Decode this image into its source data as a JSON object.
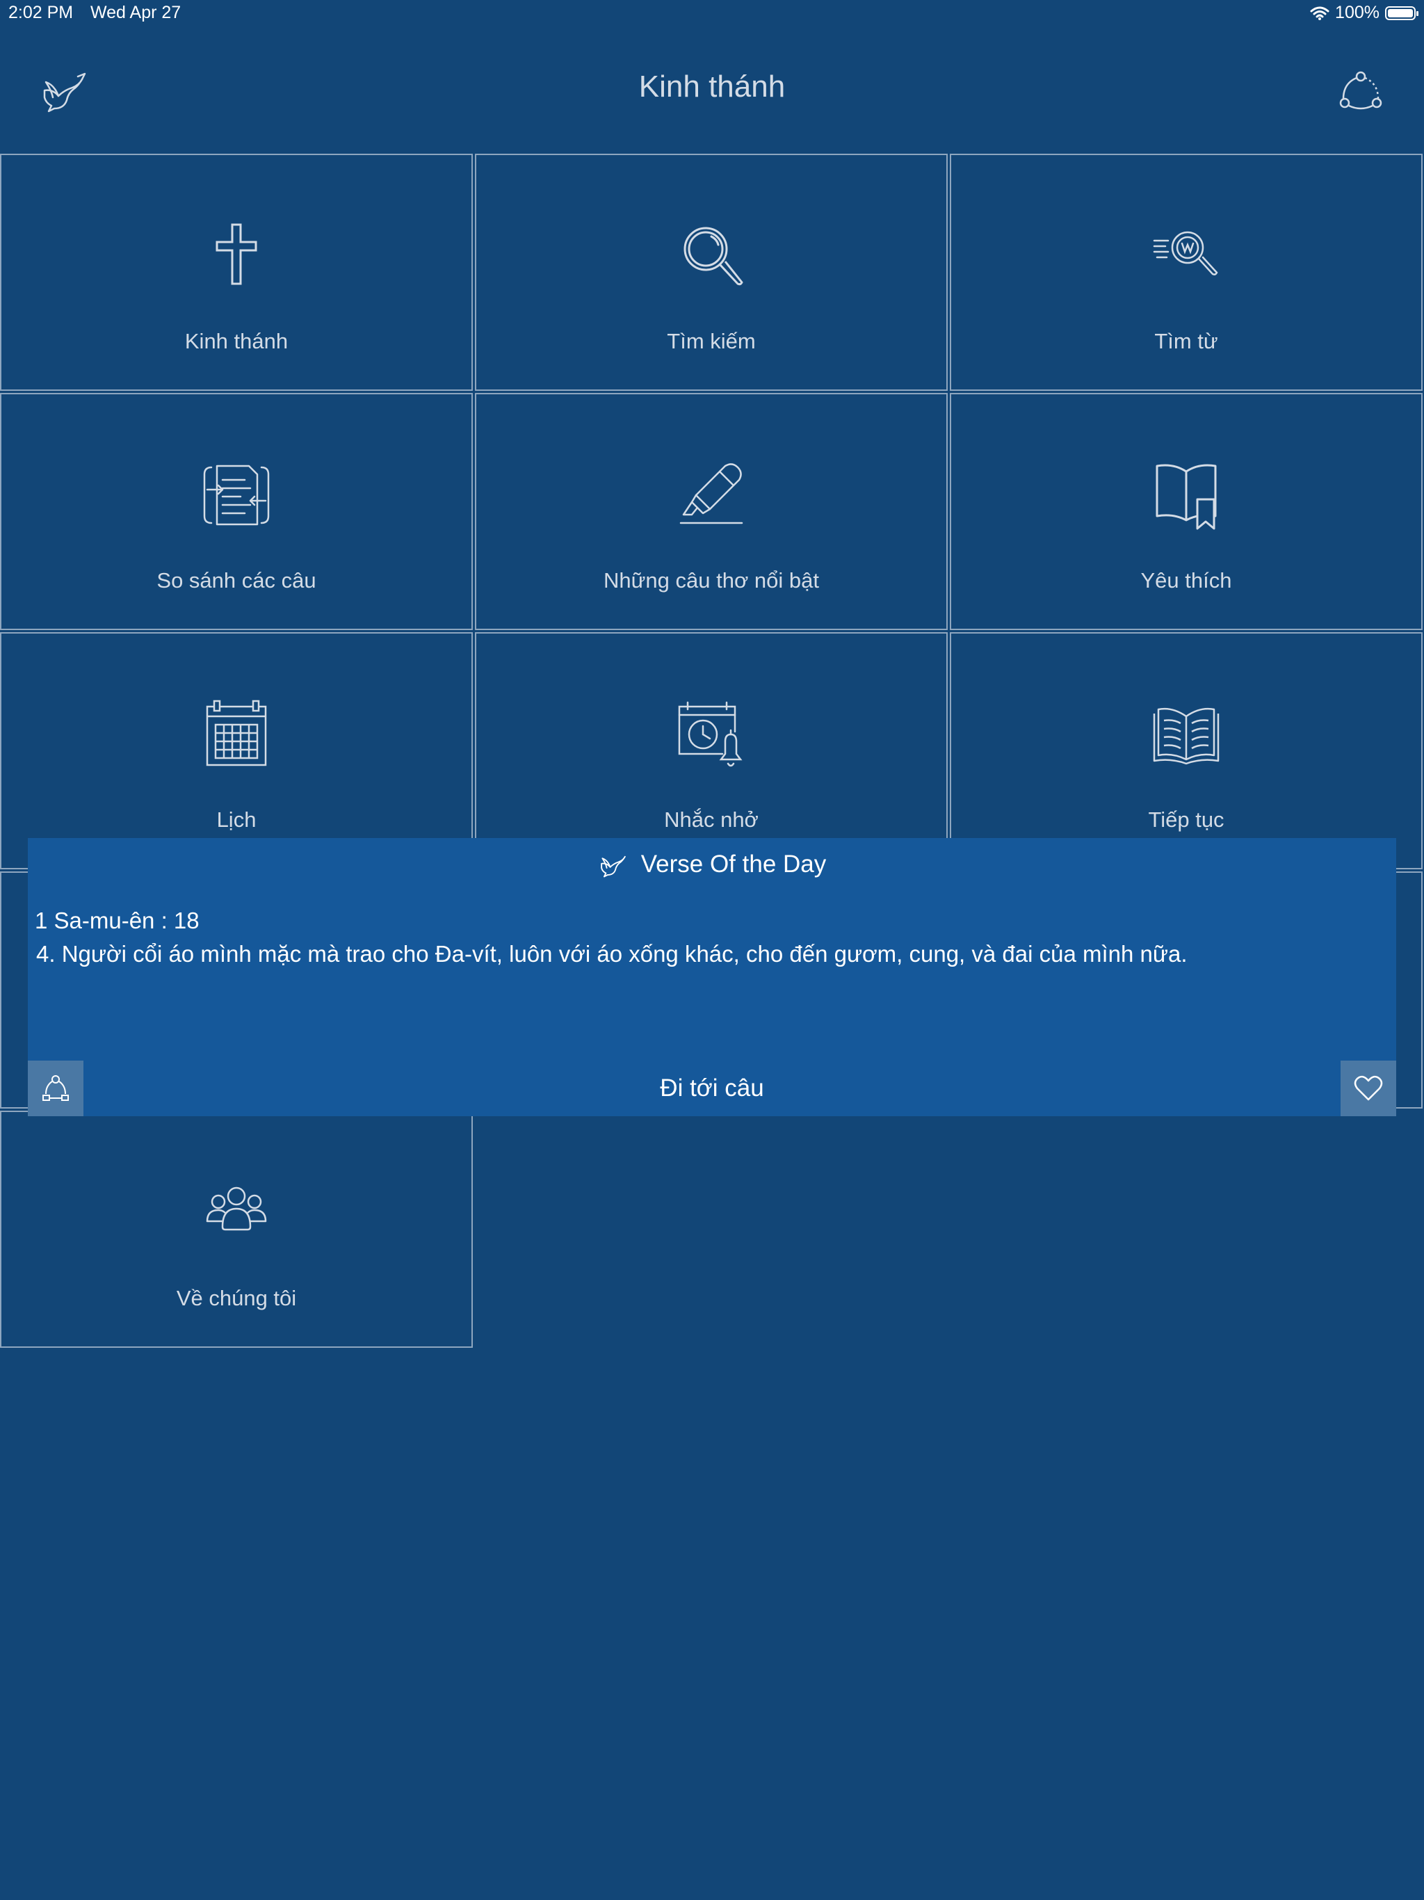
{
  "status_bar": {
    "time": "2:02 PM",
    "date": "Wed Apr 27",
    "battery": "100%"
  },
  "header": {
    "title": "Kinh thánh",
    "left_icon": "dove-icon",
    "right_icon": "share-icon"
  },
  "menu": {
    "items": [
      {
        "label": "Kinh thánh",
        "icon": "cross-icon"
      },
      {
        "label": "Tìm kiếm",
        "icon": "search-icon"
      },
      {
        "label": "Tìm từ",
        "icon": "word-search-icon"
      },
      {
        "label": "So sánh các câu",
        "icon": "compare-verses-icon"
      },
      {
        "label": "Những câu thơ nổi bật",
        "icon": "highlighter-icon"
      },
      {
        "label": "Yêu thích",
        "icon": "bookmark-book-icon"
      },
      {
        "label": "Lịch",
        "icon": "calendar-icon"
      },
      {
        "label": "Nhắc nhở",
        "icon": "reminder-icon"
      },
      {
        "label": "Tiếp tục",
        "icon": "open-book-icon"
      },
      {
        "label": "Về chúng tôi",
        "icon": "people-icon"
      }
    ]
  },
  "verse_of_the_day": {
    "title": "Verse Of the Day",
    "reference": "1 Sa-mu-ên : 18",
    "text": "4. Người cổi áo mình mặc mà trao cho Đa-vít, luôn với áo xống khác, cho đến gươm, cung, và đai của mình nữa.",
    "goto_label": "Đi tới câu"
  },
  "colors": {
    "background": "#124677",
    "tile_border": "#8ea6bf",
    "popup_background": "#15589a",
    "popup_button": "#4a78a4"
  }
}
